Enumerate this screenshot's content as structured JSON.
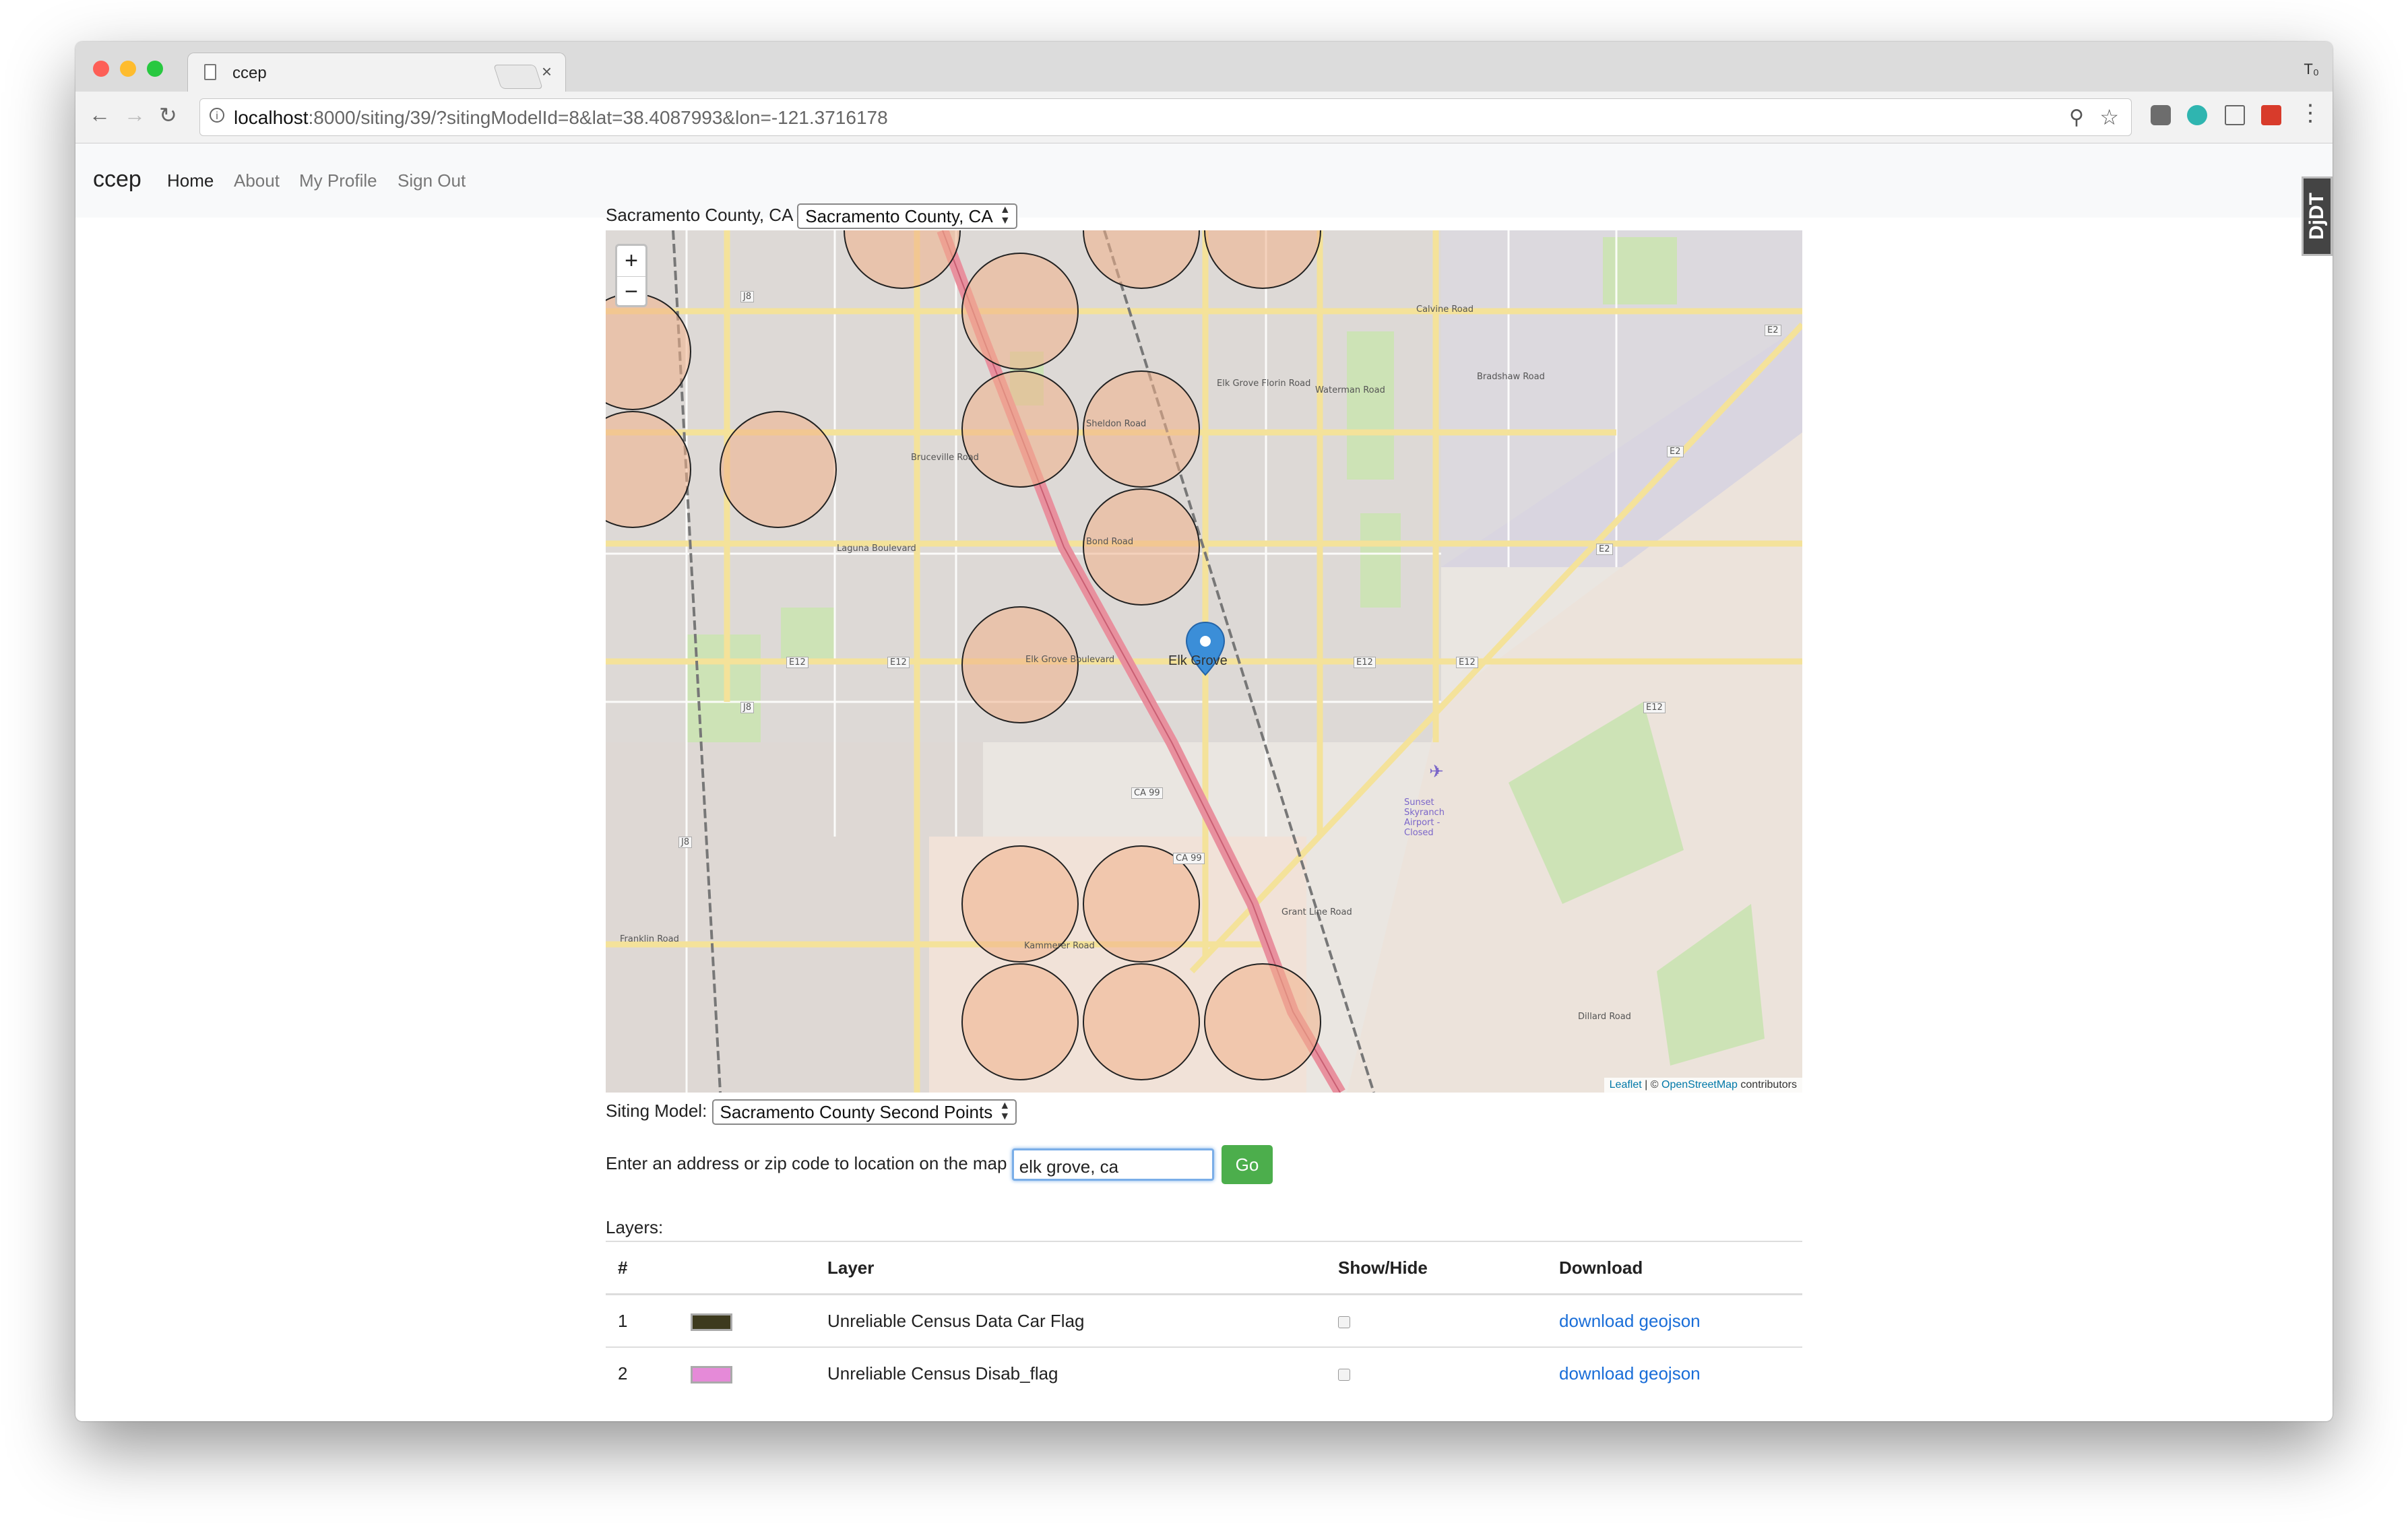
{
  "browser": {
    "tab_title": "ccep",
    "url_host": "localhost",
    "url_rest": ":8000/siting/39/?sitingModelId=8&lat=38.4087993&lon=-121.3716178",
    "user_badge": "T₀"
  },
  "navbar": {
    "brand": "ccep",
    "links": [
      "Home",
      "About",
      "My Profile",
      "Sign Out"
    ]
  },
  "devtools_label": "DjDT",
  "county": {
    "label": "Sacramento County, CA",
    "selected": "Sacramento County, CA"
  },
  "map": {
    "zoom_in": "+",
    "zoom_out": "−",
    "marker_label": "Elk Grove",
    "attribution_leaflet": "Leaflet",
    "attribution_osm": "OpenStreetMap",
    "attribution_rest": "contributors",
    "attribution_sep": "| ©",
    "road_labels": [
      "E12",
      "E12",
      "E12",
      "E12",
      "E12",
      "CA 99",
      "CA 99",
      "J8",
      "J8",
      "J8",
      "E2",
      "E2",
      "E2",
      "Calvine Road",
      "Sheldon Road",
      "Bond Road",
      "Laguna Boulevard",
      "Elk Grove Boulevard",
      "Kammerer Road",
      "Grant Line Road",
      "Waterman Road",
      "Bradshaw Road",
      "Franklin Road",
      "Bruceville Road",
      "Elk Grove Florin Road",
      "Dillard Road",
      "Sunset Skyranch Airport - Closed"
    ],
    "colors": {
      "base": "#eae6e1",
      "circle": "#f0b18a",
      "road_major": "#f6e8a4",
      "freeway": "#e8909e",
      "green": "#cde3b6"
    }
  },
  "siting": {
    "label": "Siting Model:",
    "selected": "Sacramento County Second Points"
  },
  "address": {
    "label": "Enter an address or zip code to location on the map",
    "value": "elk grove, ca",
    "button": "Go"
  },
  "layers": {
    "label": "Layers:",
    "headers": [
      "#",
      "",
      "Layer",
      "Show/Hide",
      "Download"
    ],
    "rows": [
      {
        "num": "1",
        "color": "#3d3a1e",
        "name": "Unreliable Census Data Car Flag",
        "download": "download geojson"
      },
      {
        "num": "2",
        "color": "#e58ad8",
        "name": "Unreliable Census Disab_flag",
        "download": "download geojson"
      }
    ]
  }
}
